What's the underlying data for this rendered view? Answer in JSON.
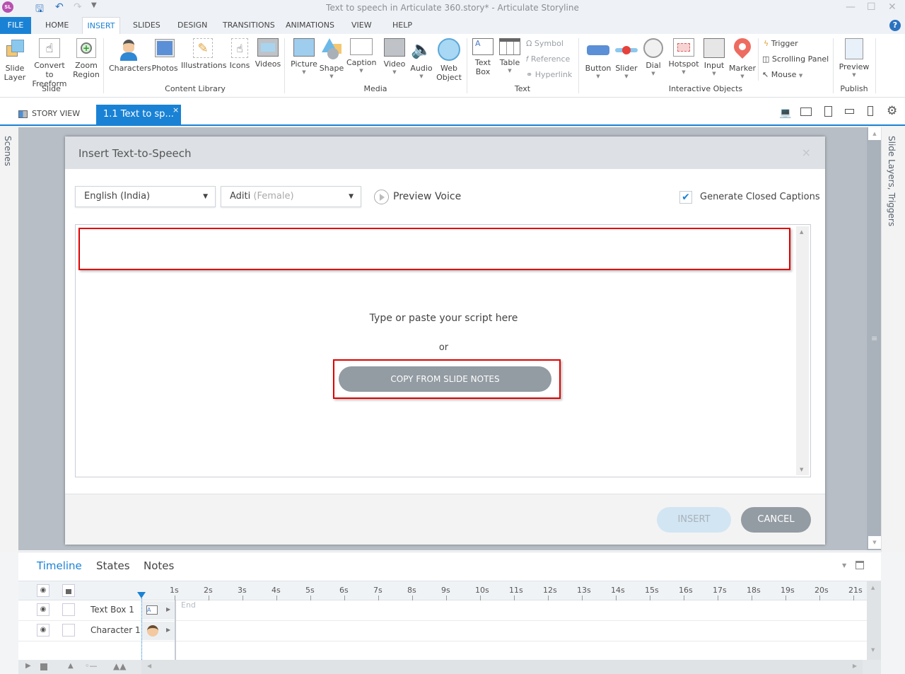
{
  "window": {
    "title": "Text to speech in Articulate 360.story* -  Articulate Storyline",
    "logo": "SL",
    "qat_icons": [
      "save-icon",
      "undo-icon",
      "redo-icon",
      "customize-icon"
    ],
    "controls": [
      "minimize",
      "maximize",
      "close"
    ]
  },
  "ribbon_tabs": [
    "FILE",
    "HOME",
    "INSERT",
    "SLIDES",
    "DESIGN",
    "TRANSITIONS",
    "ANIMATIONS",
    "VIEW",
    "HELP"
  ],
  "active_tab": "INSERT",
  "ribbon": {
    "groups": [
      {
        "label": "Slide",
        "buttons": [
          {
            "line1": "Slide",
            "line2": "Layer"
          },
          {
            "line1": "Convert to",
            "line2": "Freeform"
          },
          {
            "line1": "Zoom",
            "line2": "Region"
          }
        ]
      },
      {
        "label": "Content Library",
        "buttons": [
          {
            "line1": "Characters"
          },
          {
            "line1": "Photos"
          },
          {
            "line1": "Illustrations"
          },
          {
            "line1": "Icons"
          },
          {
            "line1": "Videos"
          }
        ]
      },
      {
        "label": "Media",
        "buttons": [
          {
            "line1": "Picture"
          },
          {
            "line1": "Shape"
          },
          {
            "line1": "Caption"
          },
          {
            "line1": "Video"
          },
          {
            "line1": "Audio"
          },
          {
            "line1": "Web",
            "line2": "Object"
          }
        ]
      },
      {
        "label": "Text",
        "buttons": [
          {
            "line1": "Text",
            "line2": "Box"
          },
          {
            "line1": "Table"
          }
        ],
        "small": [
          "Symbol",
          "Reference",
          "Hyperlink"
        ]
      },
      {
        "label": "Interactive Objects",
        "buttons": [
          {
            "line1": "Button"
          },
          {
            "line1": "Slider"
          },
          {
            "line1": "Dial"
          },
          {
            "line1": "Hotspot"
          },
          {
            "line1": "Input"
          },
          {
            "line1": "Marker"
          }
        ],
        "small": [
          "Trigger",
          "Scrolling Panel",
          "Mouse"
        ]
      },
      {
        "label": "Publish",
        "buttons": [
          {
            "line1": "Preview"
          }
        ]
      }
    ]
  },
  "tabstrip": {
    "story_view": "STORY VIEW",
    "slide_tab": "1.1 Text to sp...",
    "close": "×"
  },
  "side_panels": {
    "left": "Scenes",
    "right": "Slide Layers, Triggers"
  },
  "dialog": {
    "title": "Insert Text-to-Speech",
    "close": "×",
    "language": "English (India)",
    "voice_name": "Aditi",
    "voice_gender": "(Female)",
    "preview_voice": "Preview Voice",
    "generate_cc_label": "Generate Closed Captions",
    "generate_cc_checked": true,
    "script_placeholder": "Type or paste your script here",
    "or_text": "or",
    "copy_from_notes": "COPY FROM SLIDE NOTES",
    "insert": "INSERT",
    "cancel": "CANCEL"
  },
  "timeline": {
    "tabs": [
      "Timeline",
      "States",
      "Notes"
    ],
    "active_tab": "Timeline",
    "ticks": [
      "1s",
      "2s",
      "3s",
      "4s",
      "5s",
      "6s",
      "7s",
      "8s",
      "9s",
      "10s",
      "11s",
      "12s",
      "13s",
      "14s",
      "15s",
      "16s",
      "17s",
      "18s",
      "19s",
      "20s",
      "21s"
    ],
    "rows": [
      {
        "name": "Text Box 1"
      },
      {
        "name": "Character 1"
      }
    ],
    "end_label": "End"
  }
}
